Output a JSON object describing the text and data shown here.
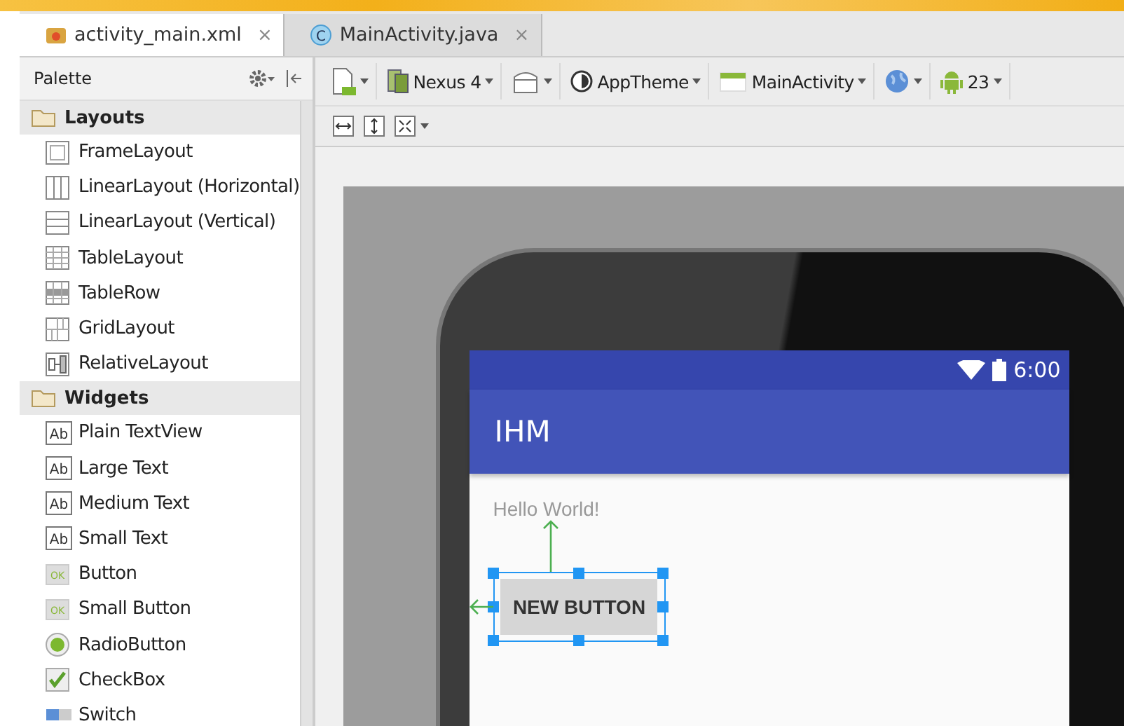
{
  "editor_tabs": [
    {
      "label": "activity_main.xml",
      "kind": "xml",
      "selected": true,
      "close": "×"
    },
    {
      "label": "MainActivity.java",
      "kind": "java",
      "glyph": "C",
      "selected": false,
      "close": "×"
    }
  ],
  "palette": {
    "title": "Palette",
    "sections": [
      {
        "label": "Layouts",
        "items": [
          {
            "label": "FrameLayout",
            "kind": "frame"
          },
          {
            "label": "LinearLayout (Horizontal)",
            "kind": "linear-h"
          },
          {
            "label": "LinearLayout (Vertical)",
            "kind": "linear-v"
          },
          {
            "label": "TableLayout",
            "kind": "table"
          },
          {
            "label": "TableRow",
            "kind": "tablerow"
          },
          {
            "label": "GridLayout",
            "kind": "grid"
          },
          {
            "label": "RelativeLayout",
            "kind": "relative"
          }
        ]
      },
      {
        "label": "Widgets",
        "items": [
          {
            "label": "Plain TextView",
            "kind": "text",
            "glyph": "Ab"
          },
          {
            "label": "Large Text",
            "kind": "text",
            "glyph": "Ab"
          },
          {
            "label": "Medium Text",
            "kind": "text",
            "glyph": "Ab"
          },
          {
            "label": "Small Text",
            "kind": "text",
            "glyph": "Ab"
          },
          {
            "label": "Button",
            "kind": "button",
            "glyph": "OK"
          },
          {
            "label": "Small Button",
            "kind": "button",
            "glyph": "OK"
          },
          {
            "label": "RadioButton",
            "kind": "radio"
          },
          {
            "label": "CheckBox",
            "kind": "checkbox"
          },
          {
            "label": "Switch",
            "kind": "switch"
          }
        ]
      }
    ]
  },
  "toolbar": [
    {
      "kind": "device-file"
    },
    {
      "kind": "device",
      "label": "Nexus 4"
    },
    {
      "kind": "orientation"
    },
    {
      "kind": "theme",
      "label": "AppTheme"
    },
    {
      "kind": "activity",
      "label": "MainActivity"
    },
    {
      "kind": "locale"
    },
    {
      "kind": "api",
      "label": "23"
    }
  ],
  "phone": {
    "time": "6:00",
    "app_title": "IHM",
    "text_view": "Hello World!",
    "button": {
      "label": "NEW BUTTON",
      "selected": true
    }
  }
}
